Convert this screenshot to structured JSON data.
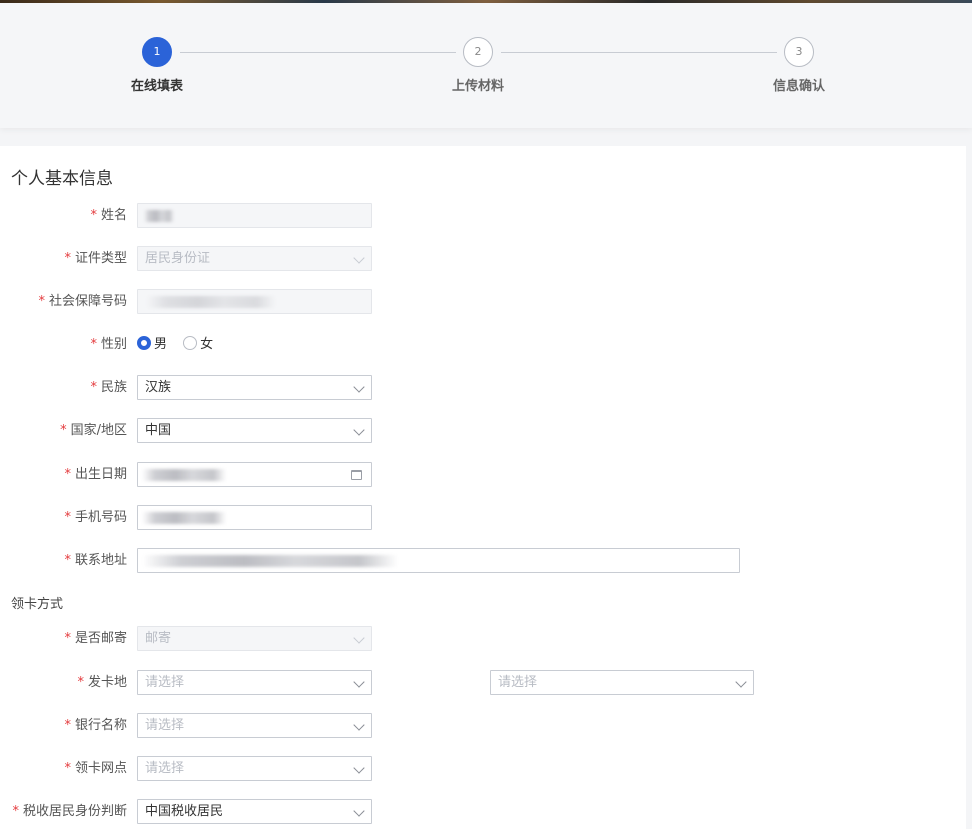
{
  "steps": [
    {
      "num": "1",
      "label": "在线填表"
    },
    {
      "num": "2",
      "label": "上传材料"
    },
    {
      "num": "3",
      "label": "信息确认"
    }
  ],
  "section_title": "个人基本信息",
  "required_mark": "*",
  "fields": {
    "name": {
      "label": "姓名"
    },
    "id_type": {
      "label": "证件类型",
      "value": "居民身份证"
    },
    "ss_number": {
      "label": "社会保障号码"
    },
    "gender": {
      "label": "性别",
      "options": [
        "男",
        "女"
      ],
      "selected": "男"
    },
    "ethnicity": {
      "label": "民族",
      "value": "汉族"
    },
    "country": {
      "label": "国家/地区",
      "value": "中国"
    },
    "birth_date": {
      "label": "出生日期"
    },
    "phone": {
      "label": "手机号码"
    },
    "address": {
      "label": "联系地址"
    }
  },
  "card_section_title": "领卡方式",
  "card_fields": {
    "mail": {
      "label": "是否邮寄",
      "value": "邮寄"
    },
    "issue_place": {
      "label": "发卡地",
      "placeholder": "请选择",
      "placeholder2": "请选择"
    },
    "bank": {
      "label": "银行名称",
      "placeholder": "请选择"
    },
    "outlet": {
      "label": "领卡网点",
      "placeholder": "请选择"
    },
    "tax_resident": {
      "label": "税收居民身份判断",
      "value": "中国税收居民"
    }
  }
}
